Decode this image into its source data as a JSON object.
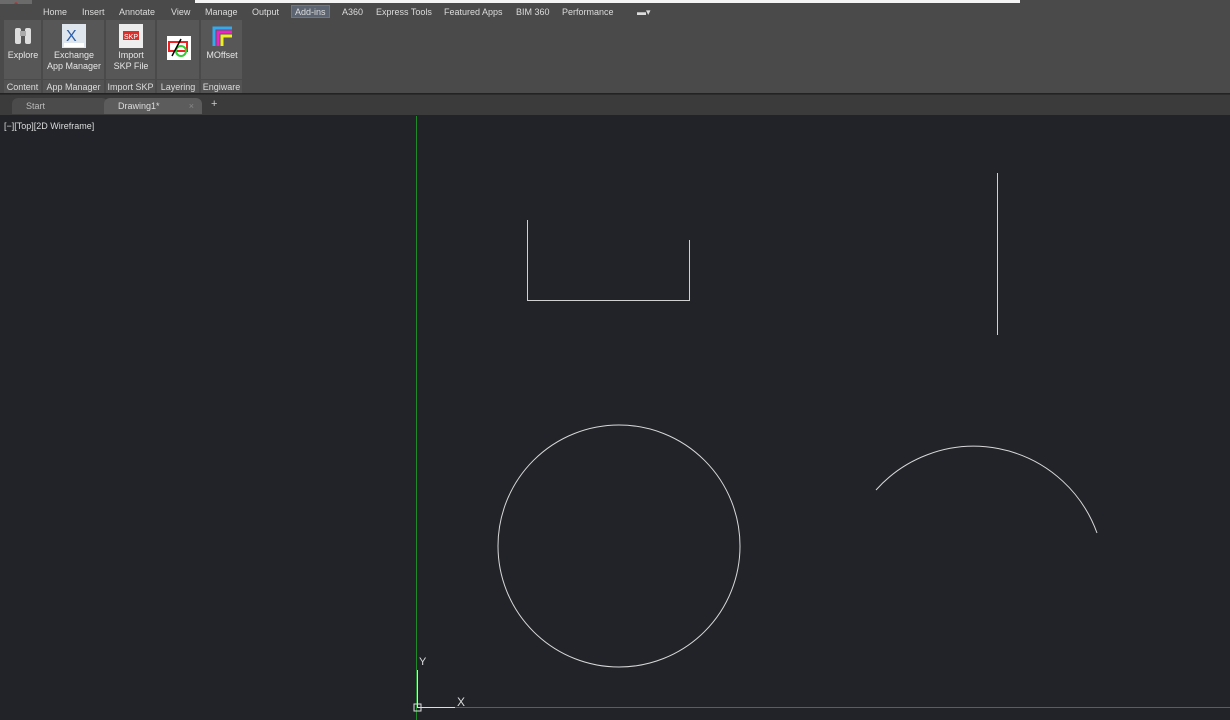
{
  "app_button": "A",
  "menu_tabs": [
    "Home",
    "Insert",
    "Annotate",
    "View",
    "Manage",
    "Output",
    "Add-ins",
    "A360",
    "Express Tools",
    "Featured Apps",
    "BIM 360",
    "Performance"
  ],
  "active_tab": "Add-ins",
  "ribbon": {
    "buttons": [
      {
        "label1": "Explore",
        "label2": "",
        "icon": "binoculars-icon"
      },
      {
        "label1": "Exchange",
        "label2": "App Manager",
        "icon": "exchange-icon"
      },
      {
        "label1": "Import",
        "label2": "SKP File",
        "icon": "skp-import-icon"
      },
      {
        "label1": "",
        "label2": "",
        "icon": "layering-icon"
      },
      {
        "label1": "MOffset",
        "label2": "",
        "icon": "moffset-icon"
      }
    ],
    "panels": [
      "Content",
      "App Manager",
      "Import SKP",
      "Layering",
      "Engiware"
    ]
  },
  "doc_tabs": [
    "Start",
    "Drawing1*"
  ],
  "close_glyph": "×",
  "add_glyph": "+",
  "viewport_label": "[−][Top][2D Wireframe]",
  "ucs": {
    "x": "X",
    "y": "Y"
  },
  "colors": {
    "background": "#212328",
    "geometry": "#d8d8d8",
    "y_axis": "#1f8a2a"
  }
}
